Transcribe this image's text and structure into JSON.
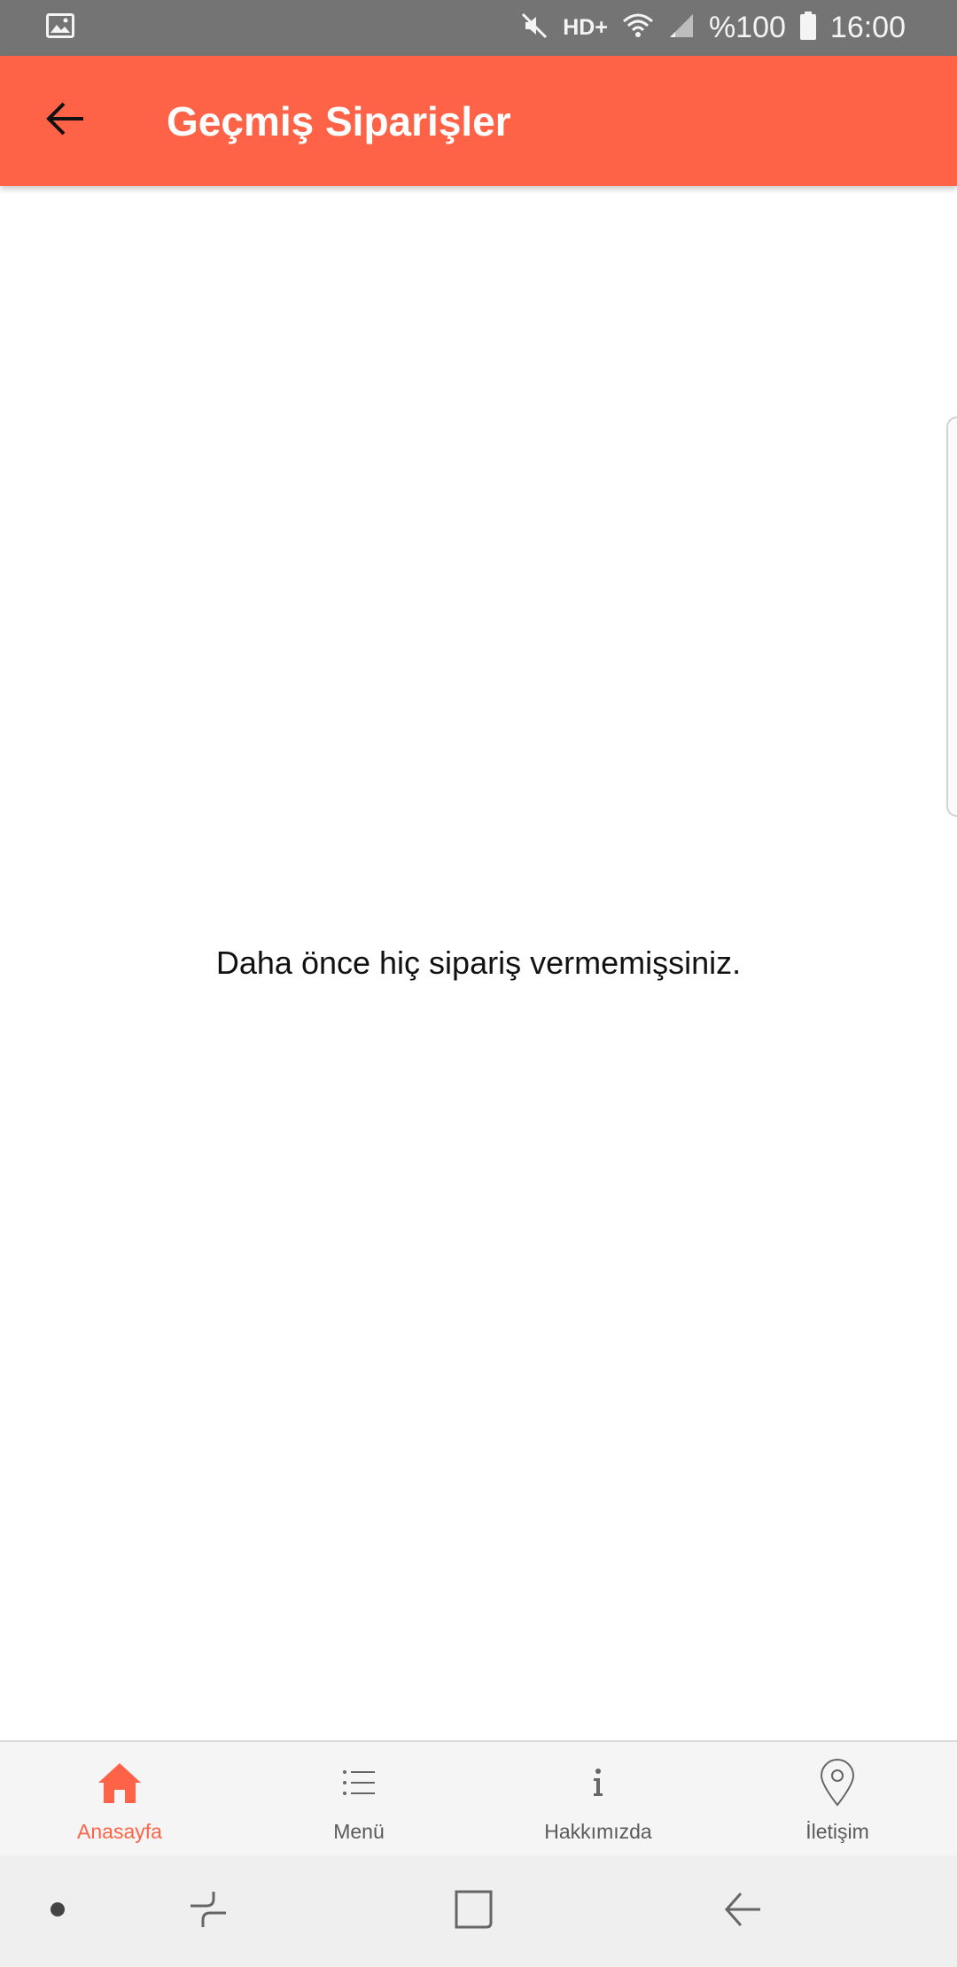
{
  "status_bar": {
    "network_label": "HD+",
    "battery_text": "%100",
    "time": "16:00",
    "icons": [
      "gallery-icon",
      "mute-icon",
      "wifi-icon",
      "signal-icon",
      "battery-icon"
    ]
  },
  "app_bar": {
    "title": "Geçmiş Siparişler",
    "back_icon": "arrow-left-icon",
    "background_color": "#ff6347"
  },
  "main": {
    "empty_message": "Daha önce hiç sipariş vermemişsiniz."
  },
  "bottom_nav": {
    "active_color": "#ff6347",
    "items": [
      {
        "label": "Anasayfa",
        "icon": "home-icon",
        "active": true
      },
      {
        "label": "Menü",
        "icon": "list-icon",
        "active": false
      },
      {
        "label": "Hakkımızda",
        "icon": "info-icon",
        "active": false
      },
      {
        "label": "İletişim",
        "icon": "location-pin-icon",
        "active": false
      }
    ]
  },
  "system_nav": {
    "icons": [
      "dot-icon",
      "recent-apps-icon",
      "home-square-icon",
      "system-back-icon"
    ]
  }
}
